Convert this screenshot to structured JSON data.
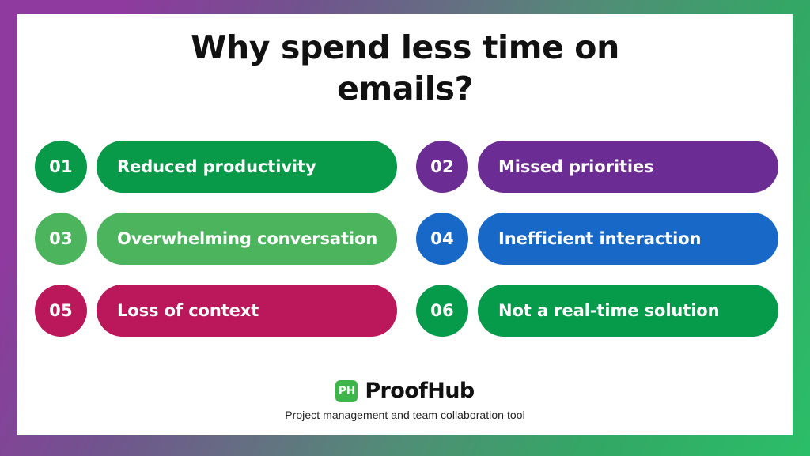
{
  "theme": {
    "frame_gradient_start": "#8E3A9E",
    "frame_gradient_end": "#2BBE68",
    "canvas_background": "#FFFFFF",
    "title_color": "#111111"
  },
  "header": {
    "title_line1": "Why spend less time on",
    "title_line2": "emails?"
  },
  "items": [
    {
      "number": "01",
      "label": "Reduced productivity",
      "color": "#089949"
    },
    {
      "number": "02",
      "label": "Missed priorities",
      "color": "#6B2D93"
    },
    {
      "number": "03",
      "label": "Overwhelming conversation",
      "color": "#4CB45C"
    },
    {
      "number": "04",
      "label": "Inefficient interaction",
      "color": "#1868C8"
    },
    {
      "number": "05",
      "label": "Loss of context",
      "color": "#BA185B"
    },
    {
      "number": "06",
      "label": "Not a real-time solution",
      "color": "#069A4B"
    }
  ],
  "footer": {
    "logo_mark_text": "PH",
    "logo_mark_color": "#3CB54A",
    "brand_name": "ProofHub",
    "tagline": "Project management and team collaboration tool"
  }
}
